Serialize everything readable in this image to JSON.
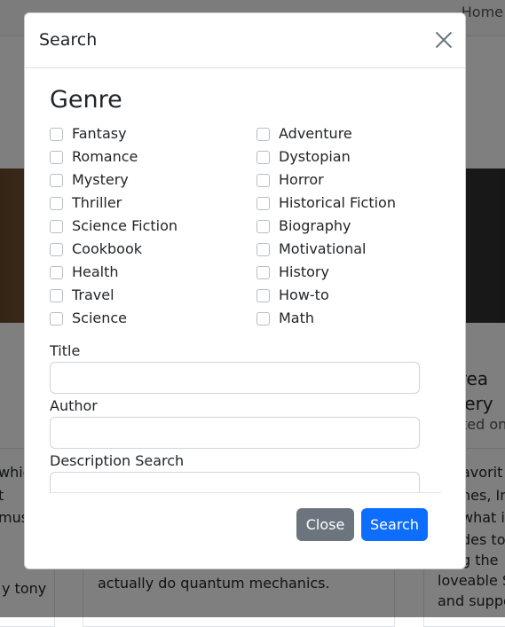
{
  "background": {
    "nav_link": "Home",
    "left_snippets": [
      "which",
      "t",
      "mus",
      "y tony"
    ],
    "center_snippet": "actually do quantum mechanics.",
    "right_title_lines": [
      "drea",
      "stery"
    ],
    "right_meta": "ted on",
    "right_snippets": [
      "avorit",
      "nes, In",
      "what is",
      "des to",
      "g the",
      "loveable S",
      "and suppo"
    ]
  },
  "modal": {
    "title": "Search",
    "genre_heading": "Genre",
    "genres_left": [
      "Fantasy",
      "Romance",
      "Mystery",
      "Thriller",
      "Science Fiction",
      "Cookbook",
      "Health",
      "Travel",
      "Science"
    ],
    "genres_right": [
      "Adventure",
      "Dystopian",
      "Horror",
      "Historical Fiction",
      "Biography",
      "Motivational",
      "History",
      "How-to",
      "Math"
    ],
    "fields": {
      "title_label": "Title",
      "title_value": "",
      "author_label": "Author",
      "author_value": "",
      "description_label": "Description Search",
      "description_value": ""
    },
    "buttons": {
      "close": "Close",
      "search": "Search"
    }
  },
  "colors": {
    "primary": "#0d6efd",
    "secondary": "#6c757d"
  }
}
